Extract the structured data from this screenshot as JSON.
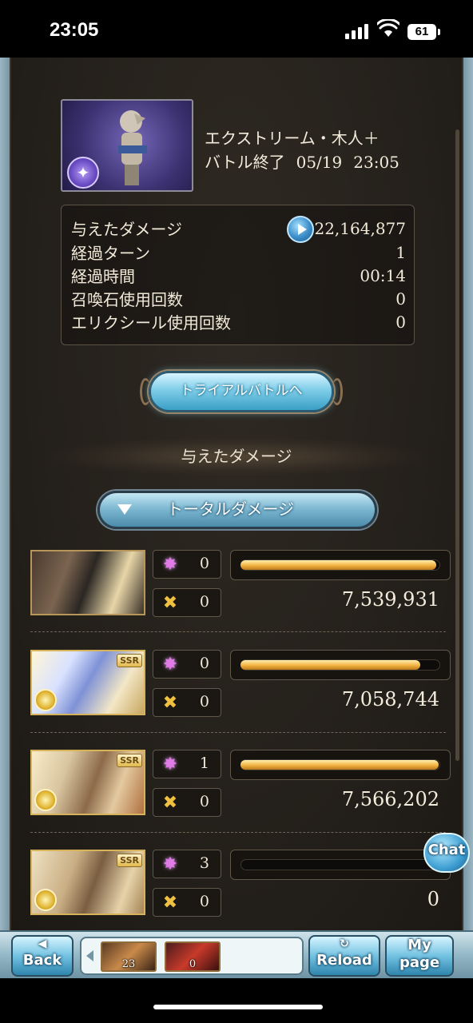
{
  "status_bar": {
    "time": "23:05",
    "battery": "61"
  },
  "battle": {
    "name": "エクストリーム・木人＋",
    "status": "バトル終了",
    "date": "05/19",
    "time": "23:05"
  },
  "stats": [
    {
      "label": "与えたダメージ",
      "value": "22,164,877"
    },
    {
      "label": "経過ターン",
      "value": "1"
    },
    {
      "label": "経過時間",
      "value": "00:14"
    },
    {
      "label": "召喚石使用回数",
      "value": "0"
    },
    {
      "label": "エリクシール使用回数",
      "value": "0"
    }
  ],
  "trial_button": "トライアルバトルへ",
  "damage_header": "与えたダメージ",
  "total_damage_button": "トータルダメージ",
  "characters": [
    {
      "skills": "0",
      "ougi": "0",
      "damage": "7,539,931",
      "gauge": 0.98,
      "rarity": ""
    },
    {
      "skills": "0",
      "ougi": "0",
      "damage": "7,058,744",
      "gauge": 0.9,
      "rarity": "SSR"
    },
    {
      "skills": "1",
      "ougi": "0",
      "damage": "7,566,202",
      "gauge": 0.99,
      "rarity": "SSR"
    },
    {
      "skills": "3",
      "ougi": "0",
      "damage": "0",
      "gauge": 0.0,
      "rarity": "SSR"
    }
  ],
  "chat_label": "Chat",
  "bottom_bar": {
    "back": "Back",
    "reload": "Reload",
    "mypage_line1": "My",
    "mypage_line2": "page",
    "items": [
      {
        "count": "23"
      },
      {
        "count": "0"
      }
    ]
  },
  "colors": {
    "accent_blue": "#3b8cc8",
    "gauge_gold": "#f2b240",
    "panel_bg": "#221e19"
  }
}
